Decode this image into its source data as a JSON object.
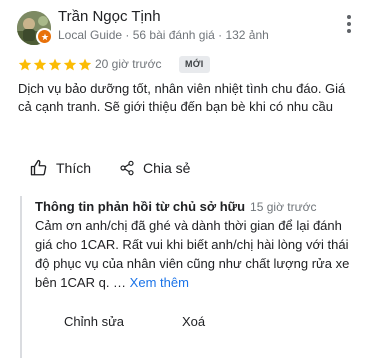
{
  "reviewer": {
    "name": "Trần Ngọc Tịnh",
    "meta": "Local Guide · 56 bài đánh giá · 132 ảnh"
  },
  "rating": {
    "stars": 5,
    "max": 5,
    "color": "#fbbc04"
  },
  "review": {
    "time": "20 giờ trước",
    "badge": "MỚI",
    "text": "Dịch vụ bảo dưỡng tốt, nhân viên nhiệt tình chu đáo. Giá cả cạnh tranh. Sẽ giới thiệu đến bạn bè khi có nhu cầu"
  },
  "actions": {
    "like_label": "Thích",
    "share_label": "Chia sẻ"
  },
  "owner_reply": {
    "title": "Thông tin phản hồi từ chủ sở hữu",
    "time": "15 giờ trước",
    "text": "Cảm ơn anh/chị đã ghé và dành thời gian để lại đánh giá cho 1CAR. Rất vui khi biết anh/chị hài lòng với thái độ phục vụ của nhân viên cũng như chất lượng rửa xe bên 1CAR q. …",
    "see_more": "Xem thêm",
    "edit_label": "Chỉnh sửa",
    "delete_label": "Xoá"
  },
  "icons": {
    "more": "more-vertical-icon",
    "star": "star-icon",
    "like": "thumbs-up-icon",
    "share": "share-icon",
    "local_guide": "local-guide-badge-icon"
  },
  "colors": {
    "link": "#1a73e8",
    "secondary_text": "#70757a",
    "badge_bg": "#e8eaed",
    "local_guide": "#e8710a"
  }
}
